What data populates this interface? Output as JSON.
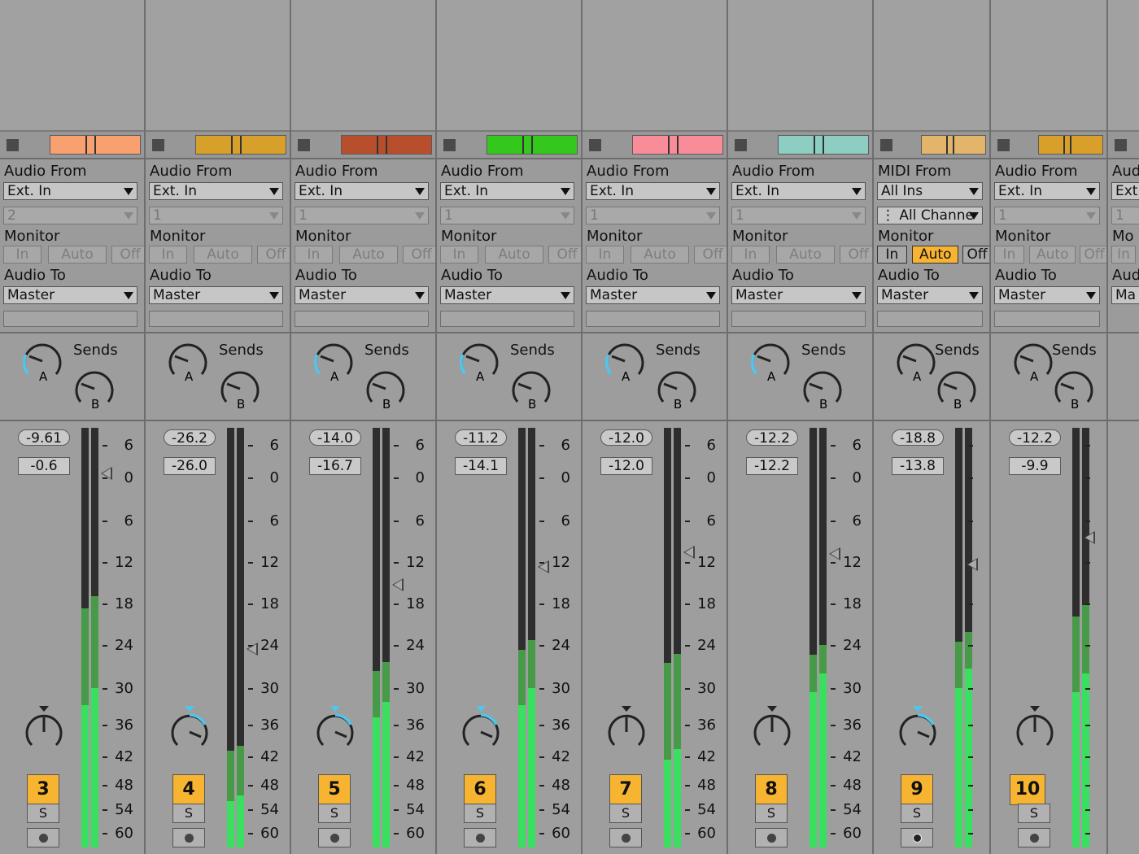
{
  "accent": "#f7b431",
  "meter_colors": {
    "bright": "#39e05f",
    "dark": "#479a47",
    "track": "#2e2e2e"
  },
  "labels": {
    "monitor": "Monitor",
    "audio_to": "Audio To",
    "sends": "Sends",
    "send_a": "A",
    "send_b": "B",
    "solo": "S"
  },
  "monitor_buttons": [
    "In",
    "Auto",
    "Off"
  ],
  "scale": [
    "6",
    "0",
    "6",
    "12",
    "18",
    "24",
    "30",
    "36",
    "42",
    "48",
    "54",
    "60"
  ],
  "tracks": [
    {
      "number": "3",
      "color": "#f8a070",
      "input_label": "Audio From",
      "input_type": "Ext. In",
      "input_channel": "2",
      "monitor": "Auto",
      "output": "Master",
      "peak": "-9.61",
      "volume": "-0.6",
      "level": 0.34,
      "level_outer": 0.57,
      "arm_icon": "record-arm-icon"
    },
    {
      "number": "4",
      "color": "#d6a02a",
      "input_label": "Audio From",
      "input_type": "Ext. In",
      "input_channel": "1",
      "monitor": "Auto",
      "output": "Master",
      "peak": "-26.2",
      "volume": "-26.0",
      "level": 0.11,
      "level_outer": 0.23,
      "arm_icon": "record-arm-icon"
    },
    {
      "number": "5",
      "color": "#b84e2c",
      "input_label": "Audio From",
      "input_type": "Ext. In",
      "input_channel": "1",
      "monitor": "Auto",
      "output": "Master",
      "peak": "-14.0",
      "volume": "-16.7",
      "level": 0.31,
      "level_outer": 0.42,
      "arm_icon": "record-arm-icon"
    },
    {
      "number": "6",
      "color": "#35c81c",
      "input_label": "Audio From",
      "input_type": "Ext. In",
      "input_channel": "1",
      "monitor": "Auto",
      "output": "Master",
      "peak": "-11.2",
      "volume": "-14.1",
      "level": 0.34,
      "level_outer": 0.47,
      "arm_icon": "record-arm-icon"
    },
    {
      "number": "7",
      "color": "#f88d99",
      "input_label": "Audio From",
      "input_type": "Ext. In",
      "input_channel": "1",
      "monitor": "Auto",
      "output": "Master",
      "peak": "-12.0",
      "volume": "-12.0",
      "level": 0.21,
      "level_outer": 0.44,
      "arm_icon": "record-arm-icon"
    },
    {
      "number": "8",
      "color": "#8ecdc1",
      "input_label": "Audio From",
      "input_type": "Ext. In",
      "input_channel": "1",
      "monitor": "Auto",
      "output": "Master",
      "peak": "-12.2",
      "volume": "-12.2",
      "level": 0.37,
      "level_outer": 0.46,
      "arm_icon": "record-arm-icon"
    },
    {
      "number": "9",
      "color": "#e2b56a",
      "input_label": "MIDI From",
      "input_type": "All Ins",
      "input_channel": "All Channe",
      "monitor": "Auto",
      "output": "Master",
      "peak": "-18.8",
      "volume": "-13.8",
      "level": 0.38,
      "level_outer": 0.49,
      "arm_icon": "midi-arm-icon"
    },
    {
      "number": "10",
      "color": "#d8a02a",
      "input_label": "Audio From",
      "input_type": "Ext. In",
      "input_channel": "1",
      "monitor": "Auto",
      "output": "Master",
      "peak": "-12.2",
      "volume": "-9.9",
      "level": 0.37,
      "level_outer": 0.55,
      "arm_icon": "record-arm-icon"
    }
  ],
  "partial_track": {
    "input_label": "Aud",
    "input_type": "Ext",
    "input_channel": "1",
    "monitor": "Mo",
    "monitor_btn": "In",
    "audio_to": "Aud",
    "output": "Ma"
  }
}
